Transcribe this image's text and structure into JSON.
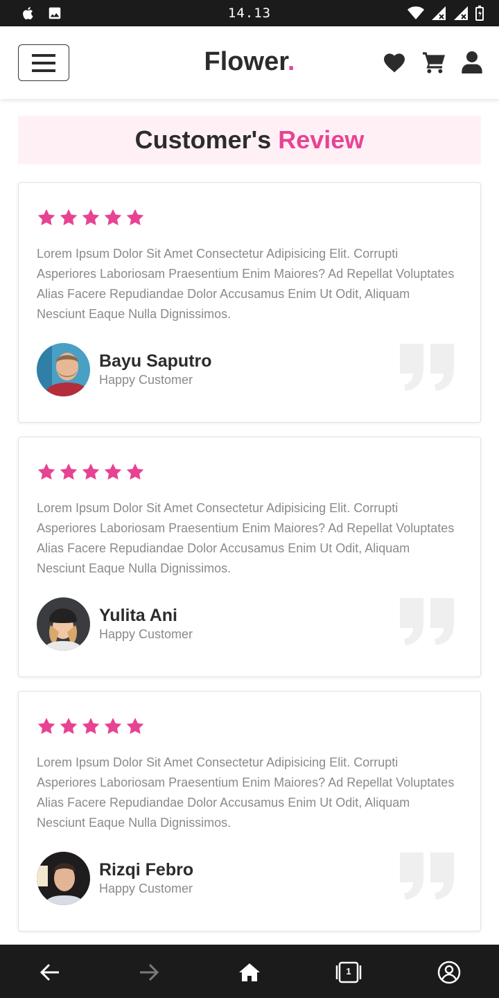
{
  "status": {
    "time": "14.13"
  },
  "header": {
    "logo": "Flower",
    "logo_dot": "."
  },
  "section": {
    "title_main": "Customer's ",
    "title_accent": "Review"
  },
  "colors": {
    "accent": "#e84393",
    "dark": "#2c2c2c",
    "muted": "#8a8a8a",
    "band": "#fff0f6"
  },
  "reviews": [
    {
      "rating": 5,
      "text": "Lorem Ipsum Dolor Sit Amet Consectetur Adipisicing Elit. Corrupti Asperiores Laboriosam Praesentium Enim Maiores? Ad Repellat Voluptates Alias Facere Repudiandae Dolor Accusamus Enim Ut Odit, Aliquam Nesciunt Eaque Nulla Dignissimos.",
      "name": "Bayu Saputro",
      "role": "Happy Customer"
    },
    {
      "rating": 5,
      "text": "Lorem Ipsum Dolor Sit Amet Consectetur Adipisicing Elit. Corrupti Asperiores Laboriosam Praesentium Enim Maiores? Ad Repellat Voluptates Alias Facere Repudiandae Dolor Accusamus Enim Ut Odit, Aliquam Nesciunt Eaque Nulla Dignissimos.",
      "name": "Yulita Ani",
      "role": "Happy Customer"
    },
    {
      "rating": 5,
      "text": "Lorem Ipsum Dolor Sit Amet Consectetur Adipisicing Elit. Corrupti Asperiores Laboriosam Praesentium Enim Maiores? Ad Repellat Voluptates Alias Facere Repudiandae Dolor Accusamus Enim Ut Odit, Aliquam Nesciunt Eaque Nulla Dignissimos.",
      "name": "Rizqi Febro",
      "role": "Happy Customer"
    }
  ],
  "icons": {
    "status_left": [
      "apple-icon",
      "image-icon"
    ],
    "status_right": [
      "wifi-icon",
      "signal-icon",
      "signal-icon",
      "battery-icon"
    ],
    "header": [
      "heart-icon",
      "cart-icon",
      "user-icon"
    ],
    "nav": [
      "back-arrow-icon",
      "forward-arrow-icon",
      "home-icon",
      "tabs-icon",
      "account-icon"
    ]
  },
  "nav": {
    "tab_count": "1"
  }
}
